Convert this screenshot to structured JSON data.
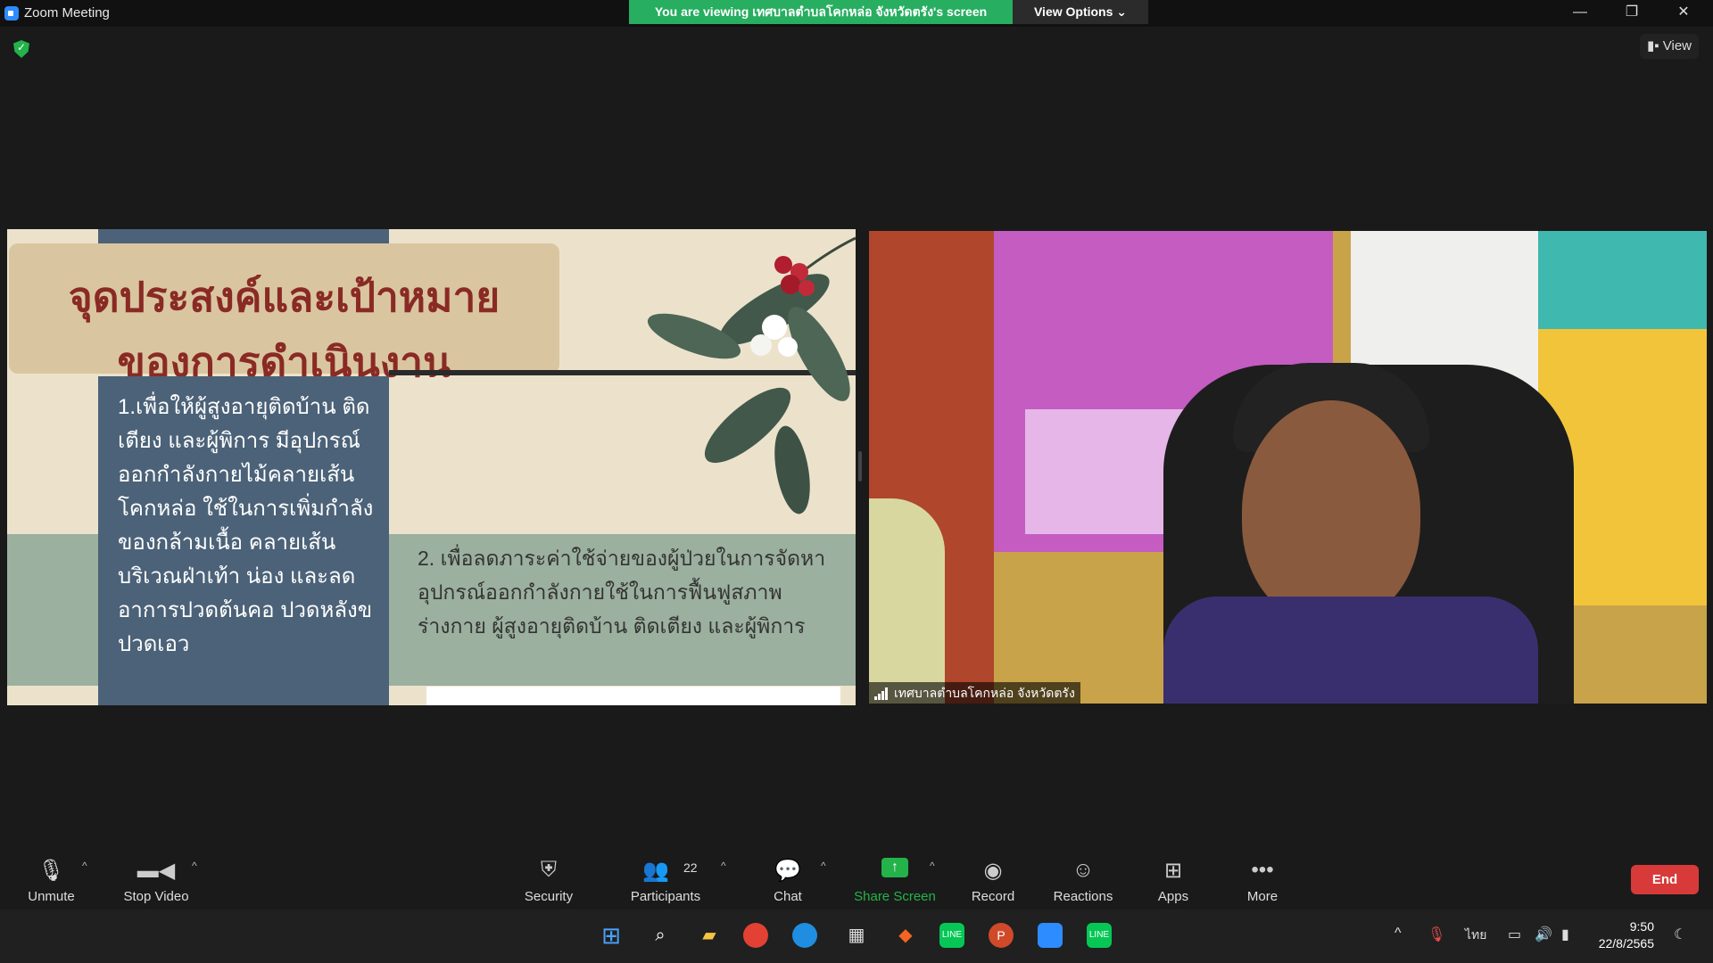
{
  "window": {
    "title": "Zoom Meeting",
    "banner": "You are viewing เทศบาลตำบลโคกหล่อ จังหวัดตรัง's screen",
    "view_options": "View Options ⌄",
    "minimize": "—",
    "restore": "❐",
    "close": "✕"
  },
  "view_button": "View",
  "slide": {
    "title_line1": "จุดประสงค์และเป้าหมาย",
    "title_line2": "ของการดำเนินงาน",
    "point1": "1.เพื่อให้ผู้สูงอายุติดบ้าน ติดเตียง และผู้พิการ มีอุปกรณ์ออกกำลังกายไม้คลายเส้นโคกหล่อ ใช้ในการเพิ่มกำลังของกล้ามเนื้อ คลายเส้นบริเวณฝ่าเท้า น่อง และลดอาการปวดต้นคอ ปวดหลังขปวดเอว",
    "point2": "2. เพื่อลดภาระค่าใช้จ่ายของผู้ป่วยในการจัดหาอุปกรณ์ออกกำลังกายใช้ในการฟื้นฟูสภาพร่างกาย ผู้สูงอายุติดบ้าน ติดเตียง และผู้พิการ"
  },
  "video": {
    "participant_name": "เทศบาลตำบลโคกหล่อ จังหวัดตรัง"
  },
  "toolbar": {
    "unmute": "Unmute",
    "stop_video": "Stop Video",
    "security": "Security",
    "participants": "Participants",
    "participants_count": "22",
    "chat": "Chat",
    "share_screen": "Share Screen",
    "record": "Record",
    "reactions": "Reactions",
    "apps": "Apps",
    "more": "More",
    "end": "End"
  },
  "taskbar": {
    "language": "ไทย",
    "time": "9:50",
    "date": "22/8/2565"
  },
  "colors": {
    "banner_green": "#27ae60",
    "end_red": "#d83a3a",
    "share_green": "#23b34a",
    "slide_title": "#8a2a25"
  }
}
